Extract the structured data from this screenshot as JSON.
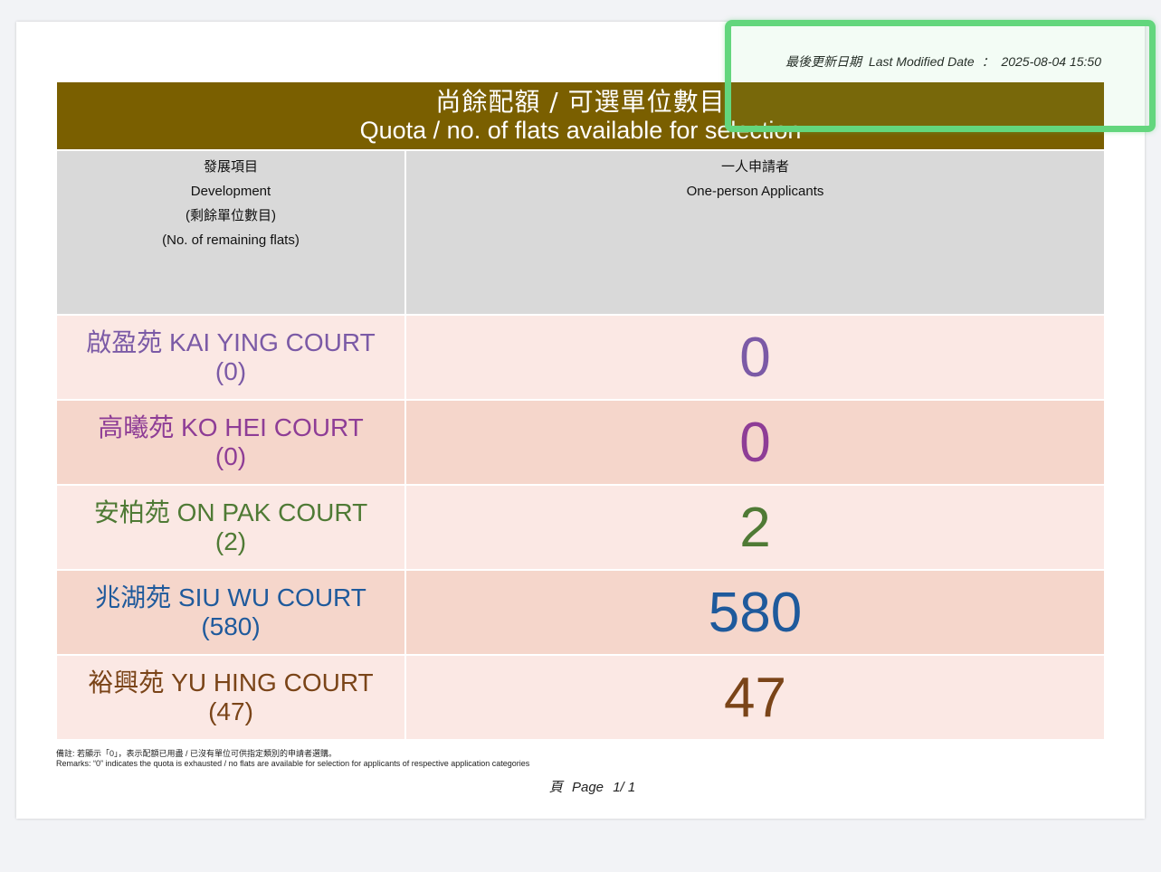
{
  "last_modified": {
    "label_zh": "最後更新日期",
    "label_en": "Last Modified Date",
    "separator": "：",
    "value": "2025-08-04 15:50"
  },
  "title": {
    "zh": "尚餘配額 / 可選單位數目",
    "en": "Quota / no. of flats available for selection"
  },
  "headers": {
    "development": [
      "發展項目",
      "Development",
      "(剩餘單位數目)",
      "(No. of remaining flats)"
    ],
    "applicants": [
      "一人申請者",
      "One-person Applicants"
    ]
  },
  "rows": [
    {
      "name_zh": "啟盈苑",
      "name_en": "KAI YING COURT",
      "remaining": "(0)",
      "quota": "0",
      "color": "#7b5aa6",
      "bg": "light"
    },
    {
      "name_zh": "高曦苑",
      "name_en": "KO HEI COURT",
      "remaining": "(0)",
      "quota": "0",
      "color": "#8e3d96",
      "bg": "light"
    },
    {
      "name_zh": "安柏苑",
      "name_en": "ON PAK COURT",
      "remaining": "(2)",
      "quota": "2",
      "color": "#4f7a35",
      "bg": "light"
    },
    {
      "name_zh": "兆湖苑",
      "name_en": "SIU WU COURT",
      "remaining": "(580)",
      "quota": "580",
      "color": "#1f5a9c",
      "bg": "dark"
    },
    {
      "name_zh": "裕興苑",
      "name_en": "YU HING COURT",
      "remaining": "(47)",
      "quota": "47",
      "color": "#7a4418",
      "bg": "light"
    }
  ],
  "remarks": {
    "zh": "備註: 若顯示「0」，表示配額已用盡 / 已沒有單位可供指定類別的申請者選購。",
    "en": "Remarks: “0” indicates the quota is exhausted / no flats are available for selection for applicants of respective application categories"
  },
  "pagination": {
    "label_zh": "頁",
    "label_en": "Page",
    "current": "1",
    "separator": "/",
    "total": "1"
  },
  "colors": {
    "title_bar": "#7a5f00",
    "header_bg": "#d9d9d9",
    "row_light": "#fbe8e4",
    "row_dark": "#f5d6cb",
    "highlight": "#63d67d"
  }
}
